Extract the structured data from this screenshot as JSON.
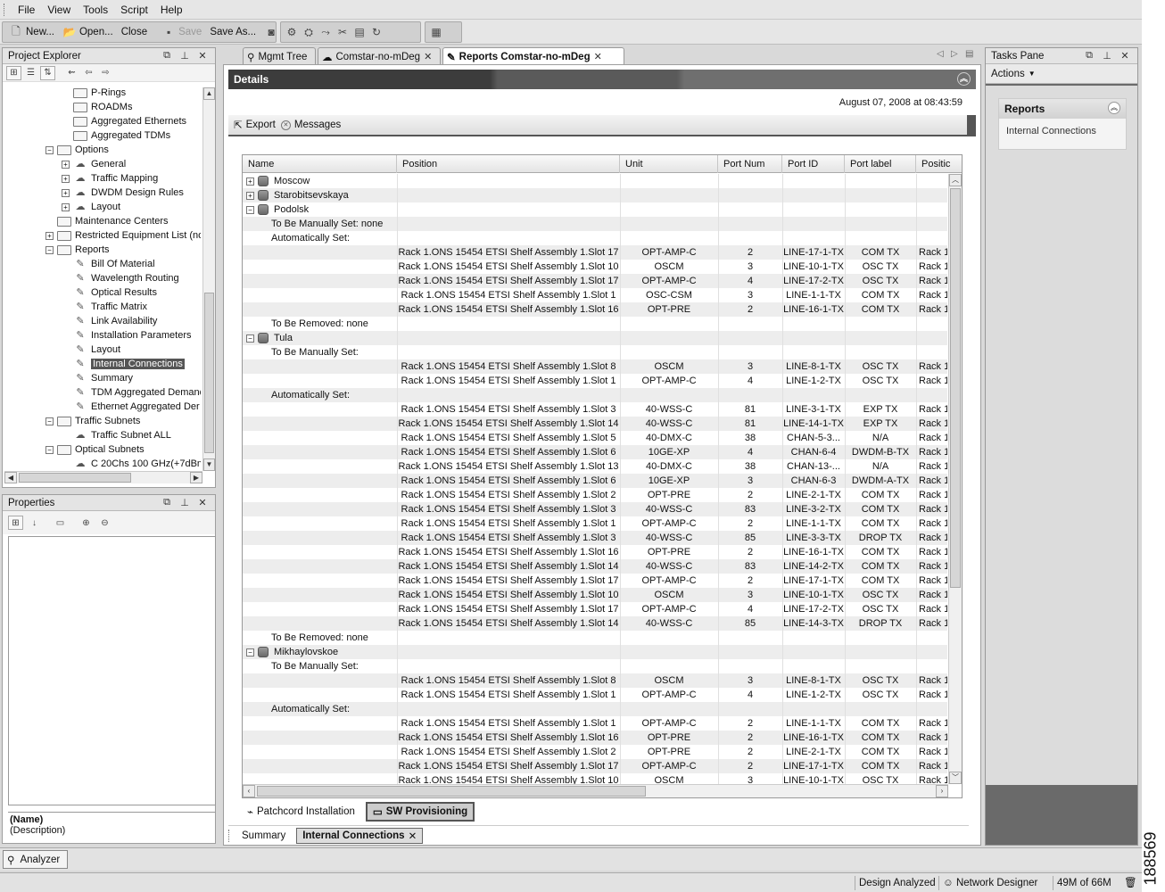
{
  "menu": [
    "File",
    "View",
    "Tools",
    "Script",
    "Help"
  ],
  "toolbar": {
    "new_label": "New...",
    "open_label": "Open...",
    "close_label": "Close",
    "save_label": "Save",
    "save_as_label": "Save As..."
  },
  "project_explorer": {
    "title": "Project Explorer",
    "tree": [
      {
        "label": "P-Rings",
        "level": 3,
        "type": "folder"
      },
      {
        "label": "ROADMs",
        "level": 3,
        "type": "folder"
      },
      {
        "label": "Aggregated Ethernets",
        "level": 3,
        "type": "folder"
      },
      {
        "label": "Aggregated TDMs",
        "level": 3,
        "type": "folder"
      },
      {
        "label": "Options",
        "level": 2,
        "type": "folder-open",
        "expander": "−"
      },
      {
        "label": "General",
        "level": 3,
        "type": "options",
        "expander": "+"
      },
      {
        "label": "Traffic Mapping",
        "level": 3,
        "type": "options",
        "expander": "+"
      },
      {
        "label": "DWDM Design Rules",
        "level": 3,
        "type": "options",
        "expander": "+"
      },
      {
        "label": "Layout",
        "level": 3,
        "type": "options",
        "expander": "+"
      },
      {
        "label": "Maintenance Centers",
        "level": 2,
        "type": "folder"
      },
      {
        "label": "Restricted Equipment List (no",
        "level": 2,
        "type": "folder",
        "expander": "+"
      },
      {
        "label": "Reports",
        "level": 2,
        "type": "folder-open",
        "expander": "−"
      },
      {
        "label": "Bill Of Material",
        "level": 3,
        "type": "report"
      },
      {
        "label": "Wavelength Routing",
        "level": 3,
        "type": "report"
      },
      {
        "label": "Optical Results",
        "level": 3,
        "type": "report"
      },
      {
        "label": "Traffic Matrix",
        "level": 3,
        "type": "report"
      },
      {
        "label": "Link Availability",
        "level": 3,
        "type": "report"
      },
      {
        "label": "Installation Parameters",
        "level": 3,
        "type": "report"
      },
      {
        "label": "Layout",
        "level": 3,
        "type": "report"
      },
      {
        "label": "Internal Connections",
        "level": 3,
        "type": "report",
        "selected": true
      },
      {
        "label": "Summary",
        "level": 3,
        "type": "report"
      },
      {
        "label": "TDM Aggregated Demand",
        "level": 3,
        "type": "report"
      },
      {
        "label": "Ethernet Aggregated Der",
        "level": 3,
        "type": "report"
      },
      {
        "label": "Traffic Subnets",
        "level": 2,
        "type": "folder-open",
        "expander": "−"
      },
      {
        "label": "Traffic Subnet ALL",
        "level": 3,
        "type": "options"
      },
      {
        "label": "Optical Subnets",
        "level": 2,
        "type": "folder-open",
        "expander": "−"
      },
      {
        "label": "C 20Chs 100 GHz(+7dBm",
        "level": 3,
        "type": "options"
      }
    ]
  },
  "properties": {
    "title": "Properties",
    "name_label": "(Name)",
    "desc_label": "(Description)"
  },
  "doc_tabs": [
    {
      "label": "Mgmt Tree",
      "active": false
    },
    {
      "label": "Comstar-no-mDeg",
      "active": false
    },
    {
      "label": "Reports Comstar-no-mDeg",
      "active": true
    }
  ],
  "details": {
    "title": "Details",
    "date": "August 07, 2008 at 08:43:59",
    "export_label": "Export",
    "messages_label": "Messages"
  },
  "table": {
    "columns": [
      "Name",
      "Position",
      "Unit",
      "Port Num",
      "Port ID",
      "Port label",
      "Positic"
    ],
    "rows": [
      {
        "kind": "site",
        "name": "Moscow",
        "exp": "+"
      },
      {
        "kind": "site",
        "name": "Starobitsevskaya",
        "exp": "+"
      },
      {
        "kind": "site",
        "name": "Podolsk",
        "exp": "−"
      },
      {
        "kind": "label",
        "name": "To Be Manually Set: none"
      },
      {
        "kind": "label",
        "name": "Automatically Set:"
      },
      {
        "kind": "data",
        "pos": "Rack 1.ONS 15454 ETSI Shelf Assembly 1.Slot 17",
        "unit": "OPT-AMP-C",
        "num": "2",
        "pid": "LINE-17-1-TX",
        "plabel": "COM TX",
        "p2": "Rack 1."
      },
      {
        "kind": "data",
        "pos": "Rack 1.ONS 15454 ETSI Shelf Assembly 1.Slot 10",
        "unit": "OSCM",
        "num": "3",
        "pid": "LINE-10-1-TX",
        "plabel": "OSC TX",
        "p2": "Rack 1."
      },
      {
        "kind": "data",
        "pos": "Rack 1.ONS 15454 ETSI Shelf Assembly 1.Slot 17",
        "unit": "OPT-AMP-C",
        "num": "4",
        "pid": "LINE-17-2-TX",
        "plabel": "OSC TX",
        "p2": "Rack 1."
      },
      {
        "kind": "data",
        "pos": "Rack 1.ONS 15454 ETSI Shelf Assembly 1.Slot 1",
        "unit": "OSC-CSM",
        "num": "3",
        "pid": "LINE-1-1-TX",
        "plabel": "COM TX",
        "p2": "Rack 1."
      },
      {
        "kind": "data",
        "pos": "Rack 1.ONS 15454 ETSI Shelf Assembly 1.Slot 16",
        "unit": "OPT-PRE",
        "num": "2",
        "pid": "LINE-16-1-TX",
        "plabel": "COM TX",
        "p2": "Rack 1."
      },
      {
        "kind": "label",
        "name": "To Be Removed: none"
      },
      {
        "kind": "site",
        "name": "Tula",
        "exp": "−"
      },
      {
        "kind": "label",
        "name": "To Be Manually Set:"
      },
      {
        "kind": "data",
        "pos": "Rack 1.ONS 15454 ETSI Shelf Assembly 1.Slot 8",
        "unit": "OSCM",
        "num": "3",
        "pid": "LINE-8-1-TX",
        "plabel": "OSC TX",
        "p2": "Rack 1."
      },
      {
        "kind": "data",
        "pos": "Rack 1.ONS 15454 ETSI Shelf Assembly 1.Slot 1",
        "unit": "OPT-AMP-C",
        "num": "4",
        "pid": "LINE-1-2-TX",
        "plabel": "OSC TX",
        "p2": "Rack 1."
      },
      {
        "kind": "label",
        "name": "Automatically Set:"
      },
      {
        "kind": "data",
        "pos": "Rack 1.ONS 15454 ETSI Shelf Assembly 1.Slot 3",
        "unit": "40-WSS-C",
        "num": "81",
        "pid": "LINE-3-1-TX",
        "plabel": "EXP TX",
        "p2": "Rack 1."
      },
      {
        "kind": "data",
        "pos": "Rack 1.ONS 15454 ETSI Shelf Assembly 1.Slot 14",
        "unit": "40-WSS-C",
        "num": "81",
        "pid": "LINE-14-1-TX",
        "plabel": "EXP TX",
        "p2": "Rack 1."
      },
      {
        "kind": "data",
        "pos": "Rack 1.ONS 15454 ETSI Shelf Assembly 1.Slot 5",
        "unit": "40-DMX-C",
        "num": "38",
        "pid": "CHAN-5-3...",
        "plabel": "N/A",
        "p2": "Rack 1."
      },
      {
        "kind": "data",
        "pos": "Rack 1.ONS 15454 ETSI Shelf Assembly 1.Slot 6",
        "unit": "10GE-XP",
        "num": "4",
        "pid": "CHAN-6-4",
        "plabel": "DWDM-B-TX",
        "p2": "Rack 1."
      },
      {
        "kind": "data",
        "pos": "Rack 1.ONS 15454 ETSI Shelf Assembly 1.Slot 13",
        "unit": "40-DMX-C",
        "num": "38",
        "pid": "CHAN-13-...",
        "plabel": "N/A",
        "p2": "Rack 1."
      },
      {
        "kind": "data",
        "pos": "Rack 1.ONS 15454 ETSI Shelf Assembly 1.Slot 6",
        "unit": "10GE-XP",
        "num": "3",
        "pid": "CHAN-6-3",
        "plabel": "DWDM-A-TX",
        "p2": "Rack 1."
      },
      {
        "kind": "data",
        "pos": "Rack 1.ONS 15454 ETSI Shelf Assembly 1.Slot 2",
        "unit": "OPT-PRE",
        "num": "2",
        "pid": "LINE-2-1-TX",
        "plabel": "COM TX",
        "p2": "Rack 1."
      },
      {
        "kind": "data",
        "pos": "Rack 1.ONS 15454 ETSI Shelf Assembly 1.Slot 3",
        "unit": "40-WSS-C",
        "num": "83",
        "pid": "LINE-3-2-TX",
        "plabel": "COM TX",
        "p2": "Rack 1."
      },
      {
        "kind": "data",
        "pos": "Rack 1.ONS 15454 ETSI Shelf Assembly 1.Slot 1",
        "unit": "OPT-AMP-C",
        "num": "2",
        "pid": "LINE-1-1-TX",
        "plabel": "COM TX",
        "p2": "Rack 1."
      },
      {
        "kind": "data",
        "pos": "Rack 1.ONS 15454 ETSI Shelf Assembly 1.Slot 3",
        "unit": "40-WSS-C",
        "num": "85",
        "pid": "LINE-3-3-TX",
        "plabel": "DROP TX",
        "p2": "Rack 1."
      },
      {
        "kind": "data",
        "pos": "Rack 1.ONS 15454 ETSI Shelf Assembly 1.Slot 16",
        "unit": "OPT-PRE",
        "num": "2",
        "pid": "LINE-16-1-TX",
        "plabel": "COM TX",
        "p2": "Rack 1."
      },
      {
        "kind": "data",
        "pos": "Rack 1.ONS 15454 ETSI Shelf Assembly 1.Slot 14",
        "unit": "40-WSS-C",
        "num": "83",
        "pid": "LINE-14-2-TX",
        "plabel": "COM TX",
        "p2": "Rack 1."
      },
      {
        "kind": "data",
        "pos": "Rack 1.ONS 15454 ETSI Shelf Assembly 1.Slot 17",
        "unit": "OPT-AMP-C",
        "num": "2",
        "pid": "LINE-17-1-TX",
        "plabel": "COM TX",
        "p2": "Rack 1."
      },
      {
        "kind": "data",
        "pos": "Rack 1.ONS 15454 ETSI Shelf Assembly 1.Slot 10",
        "unit": "OSCM",
        "num": "3",
        "pid": "LINE-10-1-TX",
        "plabel": "OSC TX",
        "p2": "Rack 1."
      },
      {
        "kind": "data",
        "pos": "Rack 1.ONS 15454 ETSI Shelf Assembly 1.Slot 17",
        "unit": "OPT-AMP-C",
        "num": "4",
        "pid": "LINE-17-2-TX",
        "plabel": "OSC TX",
        "p2": "Rack 1."
      },
      {
        "kind": "data",
        "pos": "Rack 1.ONS 15454 ETSI Shelf Assembly 1.Slot 14",
        "unit": "40-WSS-C",
        "num": "85",
        "pid": "LINE-14-3-TX",
        "plabel": "DROP TX",
        "p2": "Rack 1."
      },
      {
        "kind": "label",
        "name": "To Be Removed: none"
      },
      {
        "kind": "site",
        "name": "Mikhaylovskoe",
        "exp": "−"
      },
      {
        "kind": "label",
        "name": "To Be Manually Set:"
      },
      {
        "kind": "data",
        "pos": "Rack 1.ONS 15454 ETSI Shelf Assembly 1.Slot 8",
        "unit": "OSCM",
        "num": "3",
        "pid": "LINE-8-1-TX",
        "plabel": "OSC TX",
        "p2": "Rack 1."
      },
      {
        "kind": "data",
        "pos": "Rack 1.ONS 15454 ETSI Shelf Assembly 1.Slot 1",
        "unit": "OPT-AMP-C",
        "num": "4",
        "pid": "LINE-1-2-TX",
        "plabel": "OSC TX",
        "p2": "Rack 1."
      },
      {
        "kind": "label",
        "name": "Automatically Set:"
      },
      {
        "kind": "data",
        "pos": "Rack 1.ONS 15454 ETSI Shelf Assembly 1.Slot 1",
        "unit": "OPT-AMP-C",
        "num": "2",
        "pid": "LINE-1-1-TX",
        "plabel": "COM TX",
        "p2": "Rack 1."
      },
      {
        "kind": "data",
        "pos": "Rack 1.ONS 15454 ETSI Shelf Assembly 1.Slot 16",
        "unit": "OPT-PRE",
        "num": "2",
        "pid": "LINE-16-1-TX",
        "plabel": "COM TX",
        "p2": "Rack 1."
      },
      {
        "kind": "data",
        "pos": "Rack 1.ONS 15454 ETSI Shelf Assembly 1.Slot 2",
        "unit": "OPT-PRE",
        "num": "2",
        "pid": "LINE-2-1-TX",
        "plabel": "COM TX",
        "p2": "Rack 1."
      },
      {
        "kind": "data",
        "pos": "Rack 1.ONS 15454 ETSI Shelf Assembly 1.Slot 17",
        "unit": "OPT-AMP-C",
        "num": "2",
        "pid": "LINE-17-1-TX",
        "plabel": "COM TX",
        "p2": "Rack 1."
      },
      {
        "kind": "data",
        "pos": "Rack 1.ONS 15454 ETSI Shelf Assembly 1.Slot 10",
        "unit": "OSCM",
        "num": "3",
        "pid": "LINE-10-1-TX",
        "plabel": "OSC TX",
        "p2": "Rack 1."
      }
    ]
  },
  "bottom_tabs": {
    "patchcord": "Patchcord Installation",
    "sw_provisioning": "SW Provisioning"
  },
  "summary_tabs": {
    "summary": "Summary",
    "internal": "Internal Connections"
  },
  "tasks": {
    "title": "Tasks Pane",
    "actions": "Actions",
    "card_title": "Reports",
    "card_link": "Internal Connections"
  },
  "analyzer": {
    "label": "Analyzer"
  },
  "status": {
    "state": "Design Analyzed",
    "role": "Network Designer",
    "memory": "49M of 66M"
  },
  "figure_id": "188569"
}
